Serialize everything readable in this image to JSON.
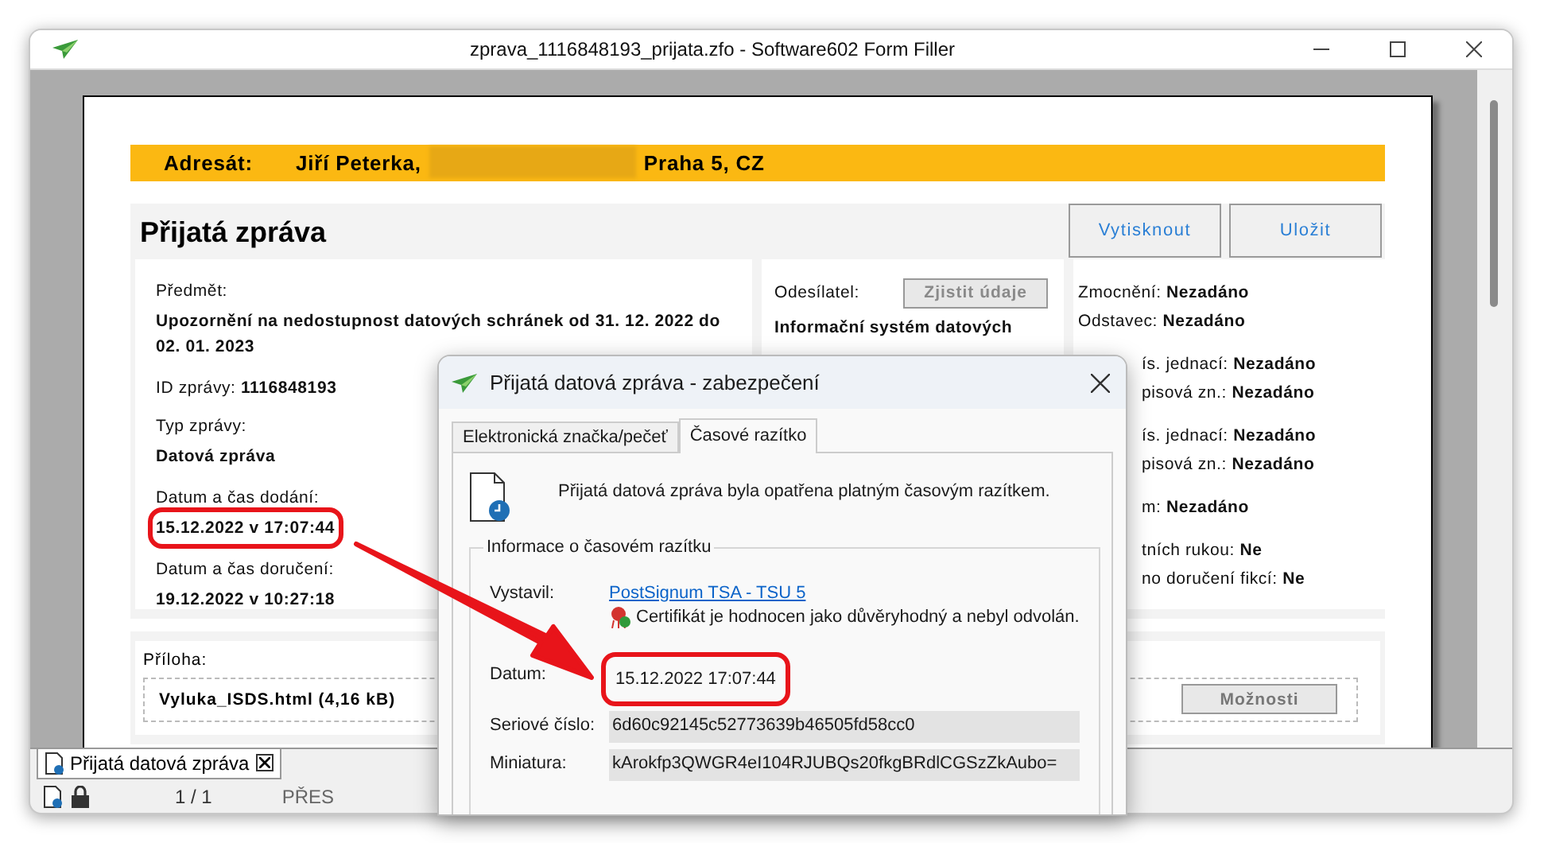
{
  "window": {
    "title": "zprava_1116848193_prijata.zfo - Software602 Form Filler"
  },
  "addressee": {
    "label": "Adresát:",
    "name": "Jiří Peterka,",
    "redacted": true,
    "city": "Praha 5, CZ"
  },
  "form": {
    "title": "Přijatá zpráva",
    "buttons": [
      "Vytisknout",
      "Uložit"
    ],
    "left_fields": [
      {
        "kind": "stacked",
        "label": "Předmět:",
        "value": "Upozornění na nedostupnost datových schránek od 31. 12. 2022 do 02. 01. 2023",
        "highlighted": false
      },
      {
        "kind": "inline",
        "label": "ID zprávy:",
        "value": "1116848193",
        "highlighted": false
      },
      {
        "kind": "stacked",
        "label": "Typ zprávy:",
        "value": "Datová zpráva",
        "highlighted": false
      },
      {
        "kind": "stacked",
        "label": "Datum a čas dodání:",
        "value": "15.12.2022 v 17:07:44",
        "highlighted": true
      },
      {
        "kind": "stacked",
        "label": "Datum a čas doručení:",
        "value": "19.12.2022 v 10:27:18",
        "highlighted": false
      }
    ],
    "sender": {
      "label": "Odesílatel:",
      "button": "Zjistit údaje",
      "value": "Informační systém datových"
    },
    "right_groups": [
      [
        {
          "kind": "full",
          "label": "Zmocnění:",
          "value": "Nezadáno"
        },
        {
          "kind": "full",
          "label": "Odstavec:",
          "value": "Nezadáno"
        }
      ],
      [
        {
          "kind": "partial",
          "label": "ís. jednací:",
          "value": "Nezadáno"
        },
        {
          "kind": "partial",
          "label": "pisová zn.:",
          "value": "Nezadáno"
        }
      ],
      [
        {
          "kind": "partial",
          "label": "ís. jednací:",
          "value": "Nezadáno"
        },
        {
          "kind": "partial",
          "label": "pisová zn.:",
          "value": "Nezadáno"
        }
      ],
      [
        {
          "kind": "partial",
          "label": "m:",
          "value": "Nezadáno"
        }
      ],
      [
        {
          "kind": "partial",
          "label": "tních rukou:",
          "value": "Ne"
        },
        {
          "kind": "partial",
          "label": "no doručení fikcí:",
          "value": "Ne"
        }
      ]
    ]
  },
  "attachment": {
    "label": "Příloha:",
    "file": "Vyluka_ISDS.html (4,16 kB)",
    "button": "Možnosti"
  },
  "document_tabs": [
    {
      "label": "Přijatá datová zpráva",
      "selected": true
    }
  ],
  "status_bar": {
    "page": "1 / 1",
    "mode": "PŘES"
  },
  "dialog": {
    "title": "Přijatá datová zpráva - zabezpečení",
    "tabs": [
      {
        "label": "Elektronická značka/pečeť",
        "selected": false
      },
      {
        "label": "Časové razítko",
        "selected": true
      }
    ],
    "message": "Přijatá datová zpráva byla opatřena platným časovým razítkem.",
    "group_title": "Informace o časovém razítku",
    "rows": [
      {
        "kind": "link",
        "label": "Vystavil:",
        "value": "PostSignum TSA - TSU 5",
        "note": "Certifikát je hodnocen jako důvěryhodný a nebyl odvolán.",
        "highlighted": false
      },
      {
        "kind": "plain",
        "label": "Datum:",
        "value": "15.12.2022 17:07:44",
        "highlighted": true
      },
      {
        "kind": "field",
        "label": "Seriové číslo:",
        "value": "6d60c92145c52773639b46505fd58cc0",
        "highlighted": false
      },
      {
        "kind": "field",
        "label": "Miniatura:",
        "value": "kArokfp3QWGR4eI104RJUBQs20fkgBRdlCGSzZkAubo=",
        "highlighted": false
      }
    ]
  }
}
